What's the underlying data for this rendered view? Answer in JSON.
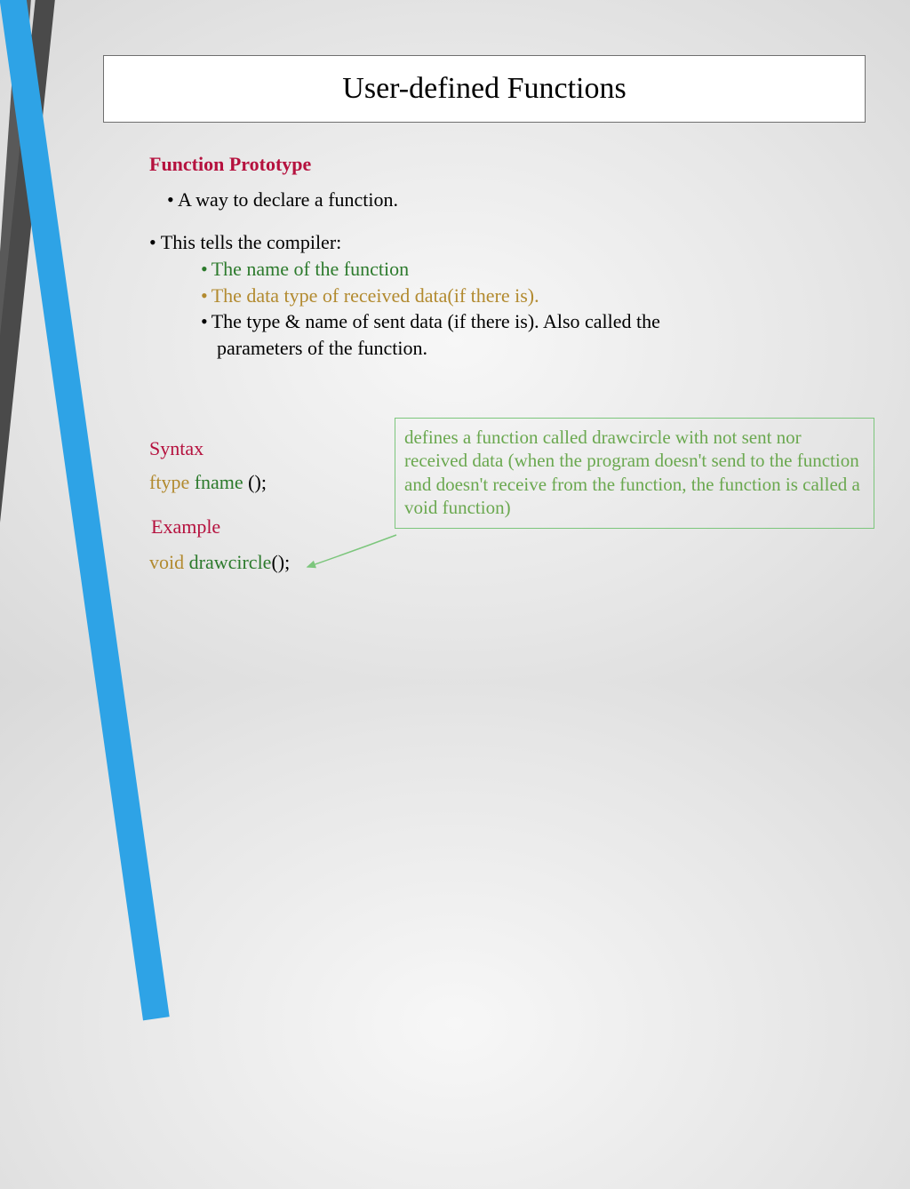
{
  "title": "User-defined Functions",
  "heading": "Function Prototype",
  "bullet1": "• A way to declare a function.",
  "bullet2": "• This tells the compiler:",
  "sub1": "The name of the function",
  "sub2": "The data type of received data(if there is).",
  "sub3": "The type & name of sent data (if there is). Also called the",
  "sub3b": "parameters of the function.",
  "syntax_label": "Syntax",
  "syntax_ftype": "ftype",
  "syntax_fname": "fname",
  "syntax_tail": " ();",
  "example_label": "Example",
  "example_void": "void",
  "example_name": " drawcircle",
  "example_tail": "();",
  "callout": "defines a function called drawcircle with not sent nor received data (when the program doesn't send to the function and doesn't receive from the function, the function is called a void function)"
}
